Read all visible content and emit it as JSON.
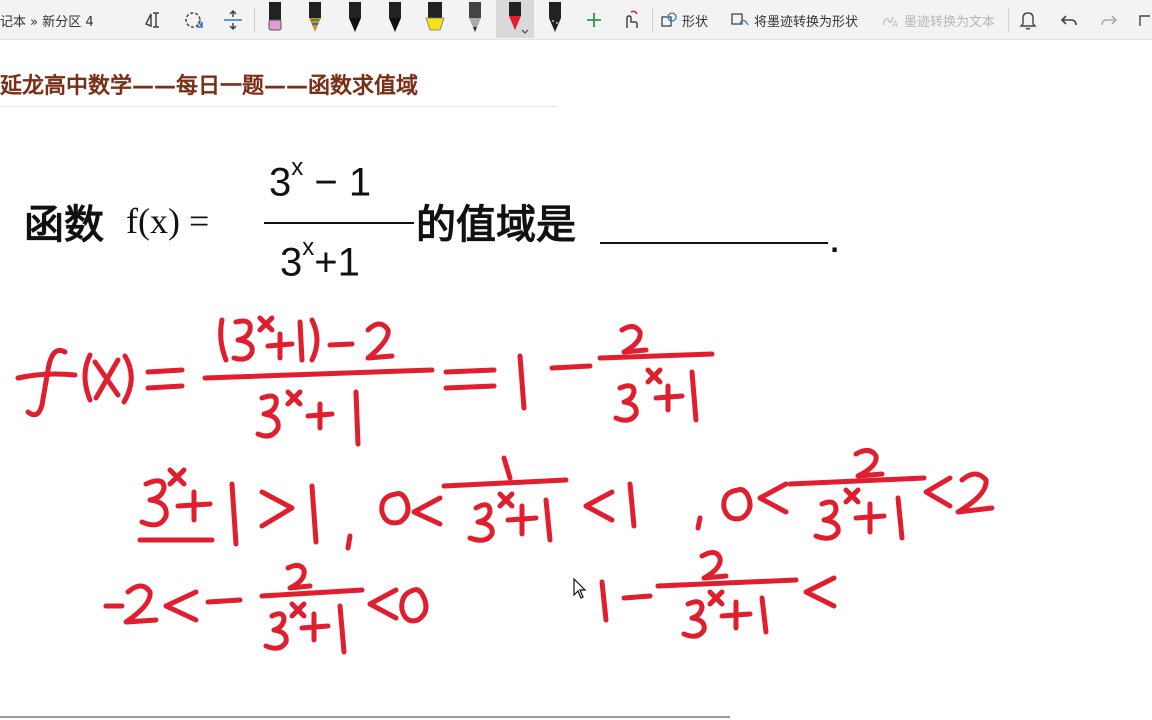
{
  "toolbar": {
    "breadcrumb": "记本 » 新分区 4",
    "pens": [
      {
        "name": "pink-highlighter-pen",
        "color": "#e59ad8"
      },
      {
        "name": "rainbow-pen",
        "color": "#d98d2b"
      },
      {
        "name": "black-pen-1",
        "color": "#111111"
      },
      {
        "name": "black-pen-2",
        "color": "#111111"
      },
      {
        "name": "yellow-highlighter-pen",
        "color": "#f7e11a"
      },
      {
        "name": "pencil-pen",
        "color": "#555555"
      },
      {
        "name": "red-pen",
        "color": "#e01e2e"
      },
      {
        "name": "galaxy-pen",
        "color": "#222222"
      }
    ],
    "add_pen_icon": "plus-icon",
    "shape_label": "形状",
    "ink_to_shape_label": "将墨迹转换为形状",
    "ink_to_text_label": "墨迹转换为文本"
  },
  "page": {
    "title": "延龙高中数学——每日一题——函数求值域"
  },
  "problem": {
    "label": "函数",
    "fx": "f(x) =",
    "numerator_base": "3",
    "numerator_exp": "x",
    "numerator_rest": " − 1",
    "denominator_base": "3",
    "denominator_exp": "x",
    "denominator_rest": "+1",
    "suffix": "的值域是",
    "end_dot": "."
  },
  "colors": {
    "ink": "#e01e2e",
    "title": "#7a2e16",
    "toolbar_bg": "#f3f3f3"
  }
}
